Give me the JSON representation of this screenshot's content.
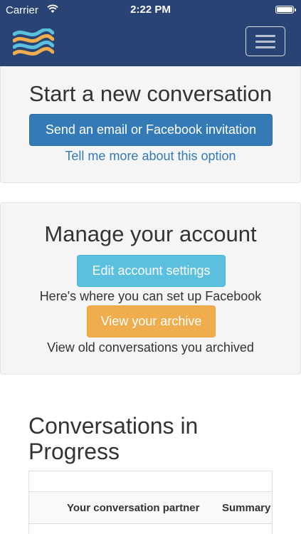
{
  "status_bar": {
    "carrier": "Carrier",
    "time": "2:22 PM",
    "wifi_icon": "wifi-icon",
    "battery_icon": "battery-icon"
  },
  "navbar": {
    "logo_icon": "wave-logo-icon",
    "menu_icon": "hamburger-menu-icon",
    "background_color": "#294474"
  },
  "new_conversation": {
    "title": "Start a new conversation",
    "invite_button": "Send an email or Facebook invitation",
    "more_info_link": "Tell me more about this option"
  },
  "manage_account": {
    "title": "Manage your account",
    "edit_settings_button": "Edit account settings",
    "edit_settings_help": "Here's where you can set up Facebook",
    "archive_button": "View your archive",
    "archive_help": "View old conversations you archived"
  },
  "conversations": {
    "title": "Conversations in Progress",
    "table_headers": [
      "Your conversation partner",
      "Summary"
    ]
  },
  "colors": {
    "primary": "#337ab7",
    "info": "#5bc0de",
    "warning": "#f0ad4e"
  }
}
